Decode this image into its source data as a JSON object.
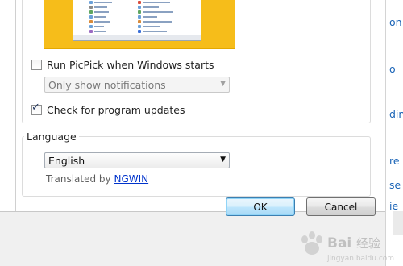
{
  "startup": {
    "run_on_start_label": "Run PicPick when Windows starts",
    "run_on_start_checked": false,
    "notification_mode": "Only show notifications",
    "check_updates_label": "Check for program updates",
    "check_updates_checked": true
  },
  "language": {
    "group_label": "Language",
    "selected": "English",
    "translated_by_prefix": "Translated by",
    "translator": "NGWIN"
  },
  "buttons": {
    "ok": "OK",
    "cancel": "Cancel"
  },
  "background_panel": {
    "fragments": [
      "on t",
      "o",
      "din",
      "re",
      "se",
      "ie"
    ]
  },
  "watermark": {
    "text": "Bai 经验",
    "sub": "jingyan.baidu.com"
  },
  "colors": {
    "preview_background": "#f6bd1a",
    "link": "#0033cc",
    "accent": "#3c7fb1"
  }
}
